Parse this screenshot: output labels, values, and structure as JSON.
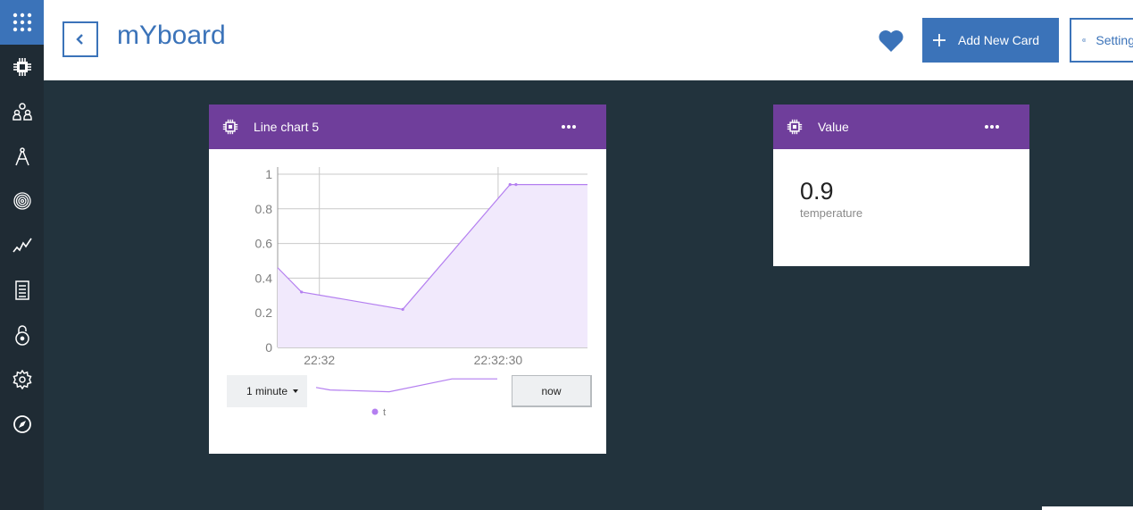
{
  "sidebar": {
    "top_icon": "app-grid-icon",
    "items": [
      {
        "icon": "device-chip-icon"
      },
      {
        "icon": "members-icon"
      },
      {
        "icon": "apps-compass-icon"
      },
      {
        "icon": "fingerprint-icon"
      },
      {
        "icon": "usage-chart-icon"
      },
      {
        "icon": "document-icon"
      },
      {
        "icon": "lock-icon"
      },
      {
        "icon": "settings-gear-icon"
      },
      {
        "icon": "navigator-icon"
      }
    ]
  },
  "header": {
    "title": "mYboard",
    "add_card_label": "Add New Card",
    "settings_label": "Settings",
    "accent_color": "#3b73b9"
  },
  "cards": {
    "chart": {
      "title": "Line chart 5",
      "range_label": "1 minute",
      "now_label": "now",
      "legend_label": "t"
    },
    "value": {
      "title": "Value",
      "number": "0.9",
      "label": "temperature"
    },
    "header_color": "#6f3e9b"
  },
  "chart_data": {
    "type": "area",
    "x": [
      "22:31:53",
      "22:31:57",
      "22:32:14",
      "22:32:32",
      "22:32:33",
      "22:32:45"
    ],
    "series": [
      {
        "name": "t",
        "values": [
          0.46,
          0.32,
          0.22,
          0.94,
          0.94,
          0.94
        ]
      }
    ],
    "yticks": [
      0,
      0.2,
      0.4,
      0.6,
      0.8,
      1
    ],
    "xticks": [
      "22:32",
      "22:32:30"
    ],
    "ylim": [
      0,
      1
    ],
    "grid": true,
    "legend": "bottom",
    "line_color": "#b47ff0",
    "fill_color": "#f1e9fc"
  }
}
